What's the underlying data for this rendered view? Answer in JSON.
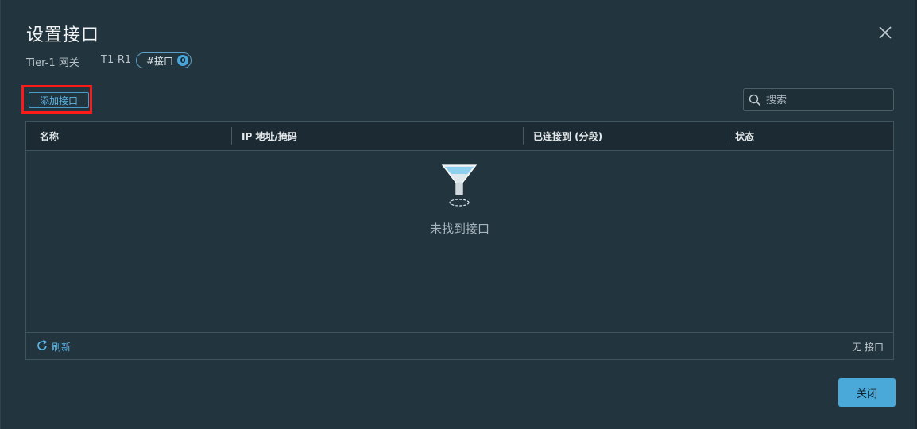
{
  "dialog": {
    "title": "设置接口",
    "gateway_type": "Tier-1 网关",
    "gateway_name": "T1-R1",
    "interfaces_pill_label": "#接口",
    "interfaces_count": "0",
    "close_button": "关闭"
  },
  "toolbar": {
    "add_interface": "添加接口",
    "search_placeholder": "搜索"
  },
  "grid": {
    "columns": [
      "名称",
      "IP 地址/掩码",
      "已连接到 (分段)",
      "状态"
    ],
    "rows": [],
    "empty_message": "未找到接口",
    "refresh_label": "刷新",
    "footer_count": "无 接口"
  },
  "colors": {
    "accent": "#49a6da",
    "highlight_box": "#ff1a1a",
    "background": "#22343e"
  },
  "icons": {
    "close": "close-icon",
    "search": "search-icon",
    "empty": "funnel-icon",
    "refresh": "refresh-icon"
  }
}
